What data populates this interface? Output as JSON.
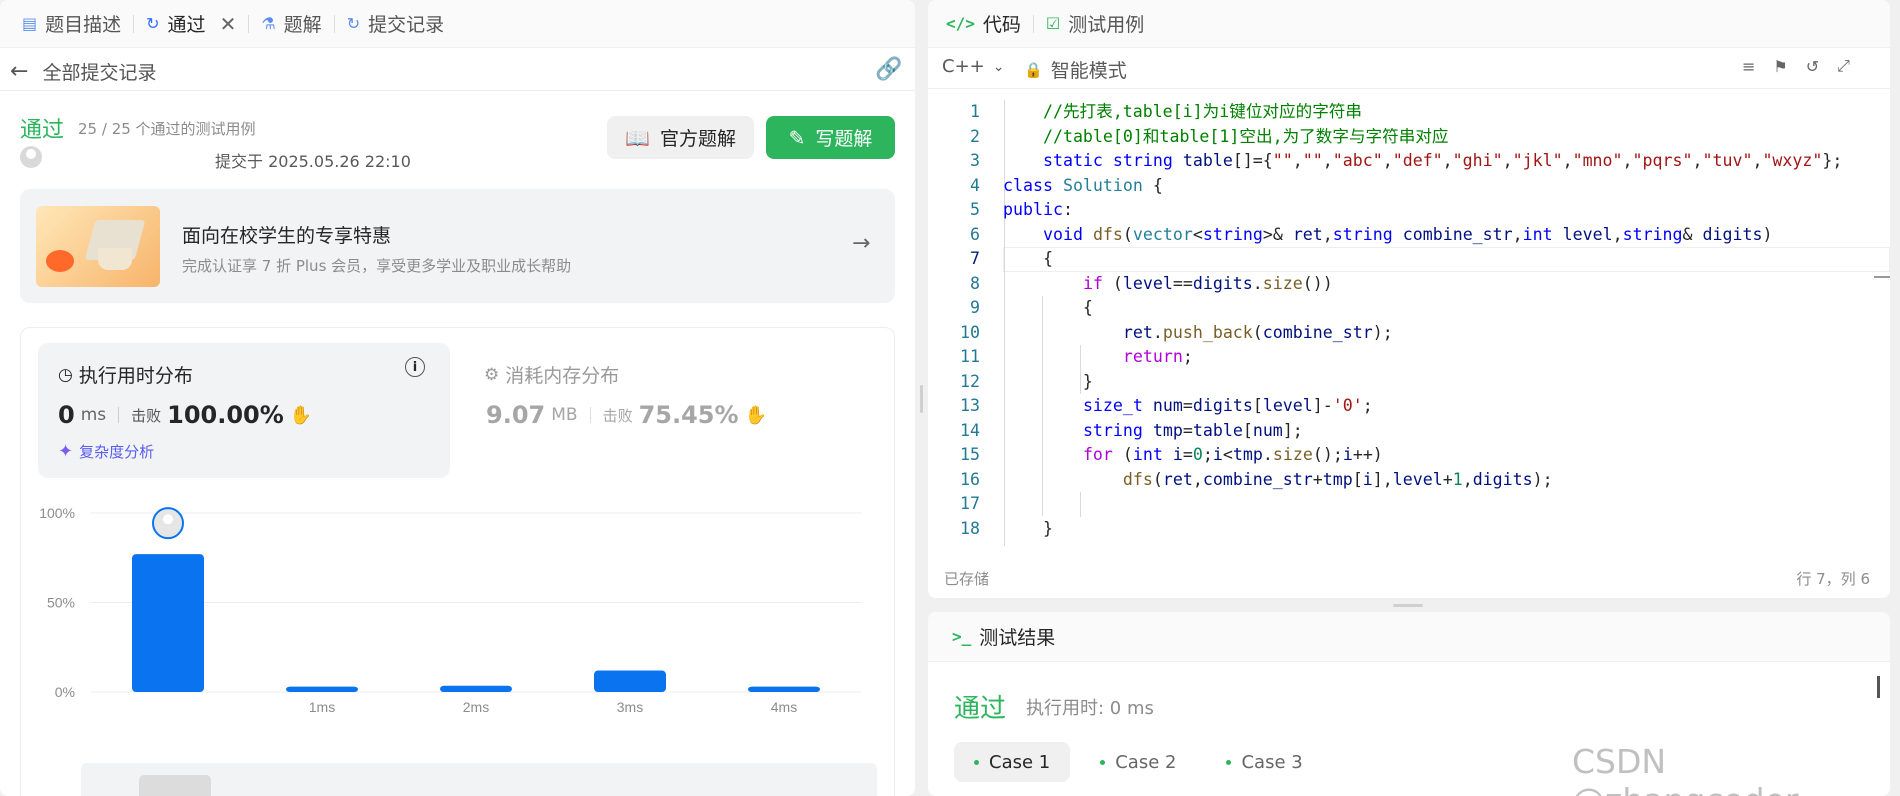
{
  "left": {
    "tabs": [
      {
        "label": "题目描述"
      },
      {
        "label": "通过"
      },
      {
        "label": "题解"
      },
      {
        "label": "提交记录"
      }
    ],
    "back_label": "全部提交记录",
    "status": "通过",
    "passed_text": "25 / 25 个通过的测试用例",
    "submitted_at": "提交于 2025.05.26 22:10",
    "official_solution_btn": "官方题解",
    "write_solution_btn": "写题解",
    "promo": {
      "title": "面向在校学生的专享特惠",
      "subtitle": "完成认证享 7 折 Plus 会员，享受更多学业及职业成长帮助"
    },
    "runtime": {
      "title": "执行用时分布",
      "value": "0",
      "unit": "ms",
      "beats_label": "击败",
      "beats_value": "100.00%",
      "complexity_link": "复杂度分析"
    },
    "memory": {
      "title": "消耗内存分布",
      "value": "9.07",
      "unit": "MB",
      "beats_label": "击败",
      "beats_value": "75.45%"
    }
  },
  "chart_data": {
    "type": "bar",
    "categories": [
      "0ms",
      "1ms",
      "2ms",
      "3ms",
      "4ms"
    ],
    "x_tick_labels": [
      "",
      "1ms",
      "2ms",
      "3ms",
      "4ms"
    ],
    "values": [
      77,
      3,
      3.5,
      12,
      3
    ],
    "ylim": [
      0,
      100
    ],
    "y_ticks": [
      "100%",
      "50%",
      "0%"
    ],
    "grid": true,
    "bar_color": "#0a74f0"
  },
  "right": {
    "tabs": [
      {
        "label": "代码"
      },
      {
        "label": "测试用例"
      }
    ],
    "language": "C++",
    "mode": "智能模式",
    "saved_label": "已存储",
    "cursor_pos": "行 7，列 6",
    "line_numbers": [
      "1",
      "2",
      "3",
      "4",
      "5",
      "6",
      "7",
      "8",
      "9",
      "10",
      "11",
      "12",
      "13",
      "14",
      "15",
      "16",
      "17",
      "18"
    ],
    "code_lines": [
      "    //先打表,table[i]为i键位对应的字符串",
      "    //table[0]和table[1]空出,为了数字与字符串对应",
      "    static string table[]={\"\",\"\",\"abc\",\"def\",\"ghi\",\"jkl\",\"mno\",\"pqrs\",\"tuv\",\"wxyz\"};",
      "class Solution {",
      "public:",
      "    void dfs(vector<string>& ret,string combine_str,int level,string& digits)",
      "    {",
      "        if (level==digits.size())",
      "        {",
      "            ret.push_back(combine_str);",
      "            return;",
      "        }",
      "        size_t num=digits[level]-'0';",
      "        string tmp=table[num];",
      "        for (int i=0;i<tmp.size();i++)",
      "            dfs(ret,combine_str+tmp[i],level+1,digits);",
      "",
      "    }"
    ]
  },
  "result": {
    "tab_label": "测试结果",
    "status": "通过",
    "runtime_text": "执行用时: 0 ms",
    "cases": [
      {
        "label": "Case 1"
      },
      {
        "label": "Case 2"
      },
      {
        "label": "Case 3"
      }
    ]
  },
  "watermark": "CSDN @zhangcoder",
  "colors": {
    "green": "#2db55d",
    "blue": "#0a74f0",
    "purple": "#7b5cf0"
  }
}
